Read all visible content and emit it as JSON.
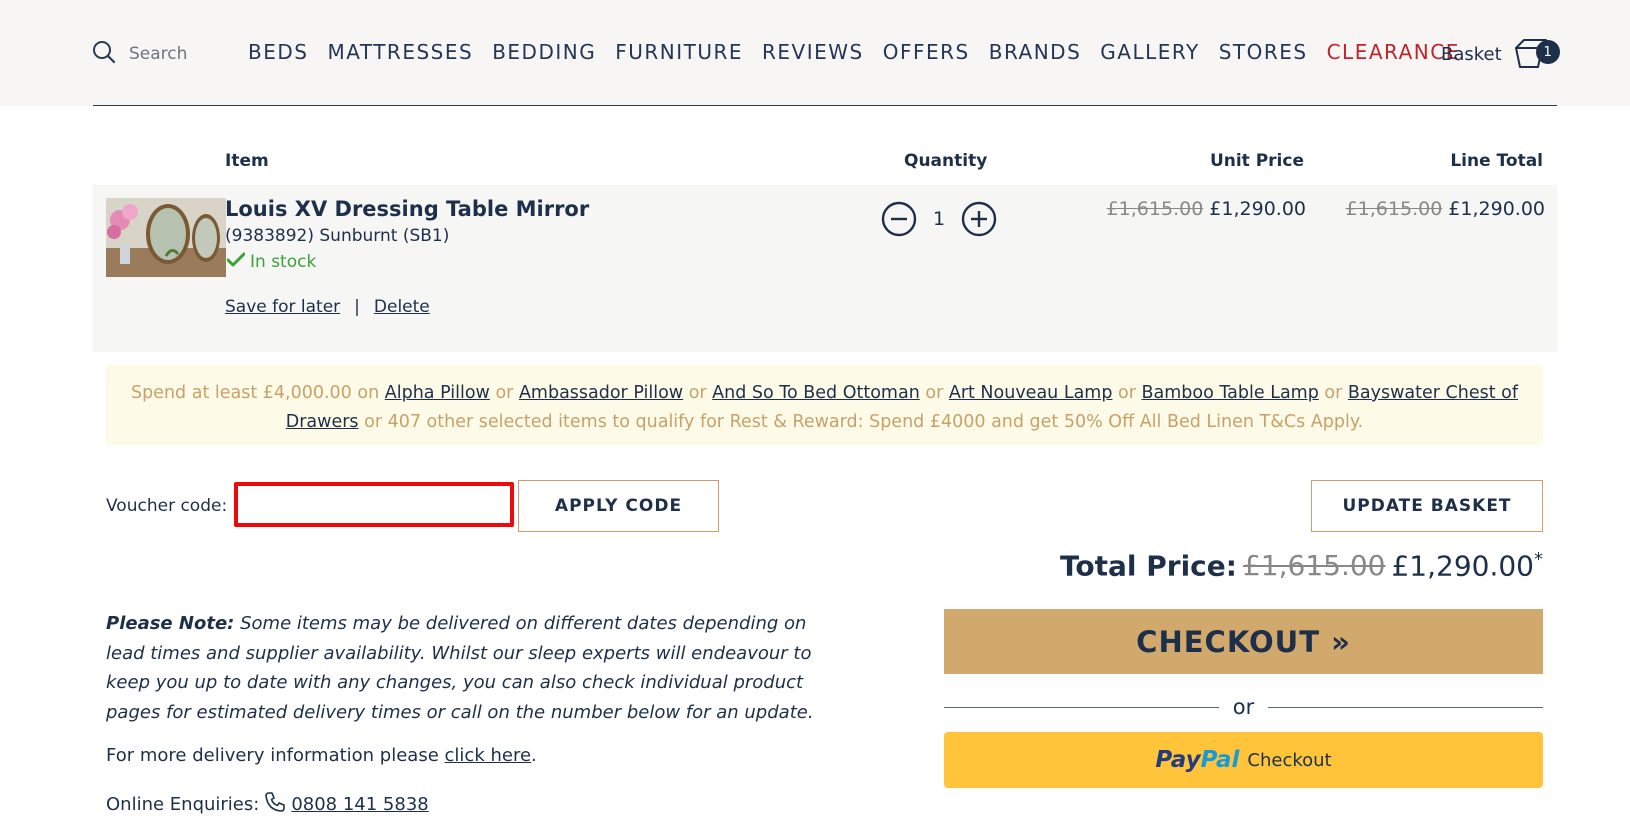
{
  "header": {
    "search_label": "Search",
    "nav": [
      "BEDS",
      "MATTRESSES",
      "BEDDING",
      "FURNITURE",
      "REVIEWS",
      "OFFERS",
      "BRANDS",
      "GALLERY",
      "STORES",
      "CLEARANCE"
    ],
    "basket_label": "Basket",
    "basket_count": "1"
  },
  "table": {
    "col_item": "Item",
    "col_quantity": "Quantity",
    "col_unit_price": "Unit Price",
    "col_line_total": "Line Total"
  },
  "item": {
    "name": "Louis XV Dressing Table Mirror",
    "sku": "(9383892) Sunburnt (SB1)",
    "stock": "In stock",
    "save_for_later": "Save for later",
    "separator": "|",
    "delete": "Delete",
    "quantity": "1",
    "unit_price_old": "£1,615.00",
    "unit_price": "£1,290.00",
    "line_total_old": "£1,615.00",
    "line_total": "£1,290.00"
  },
  "promo": {
    "intro": "Spend at least £4,000.00 on",
    "or": "or",
    "links": [
      "Alpha Pillow",
      "Ambassador Pillow",
      "And So To Bed Ottoman",
      "Art Nouveau Lamp",
      "Bamboo Table Lamp",
      "Bayswater Chest of Drawers"
    ],
    "outro": "or 407 other selected items to qualify for Rest & Reward: Spend £4000 and get 50% Off All Bed Linen T&Cs Apply."
  },
  "voucher": {
    "label": "Voucher code:",
    "value": "",
    "apply_label": "APPLY CODE",
    "update_label": "UPDATE BASKET"
  },
  "totals": {
    "label": "Total Price:",
    "old": "£1,615.00",
    "current": "£1,290.00",
    "asterisk": "*"
  },
  "checkout": {
    "label": "CHECKOUT »",
    "or": "or",
    "paypal_pay": "Pay",
    "paypal_pal": "Pal",
    "paypal_label": "Checkout"
  },
  "notes": {
    "please_note": "Please Note:",
    "note_text": "Some items may be delivered on different dates depending on lead times and supplier availability. Whilst our sleep experts will endeavour to keep you up to date with any changes, you can also check individual product pages for estimated delivery times or call on the number below for an update.",
    "delivery_text": "For more delivery information please",
    "click_here": "click here",
    "period": ".",
    "enquiries_label": "Online Enquiries:",
    "phone": "0808 141 5838"
  },
  "colors": {
    "navy": "#1e2f4a",
    "clearance_red": "#c4222a",
    "gold": "#d2a96d",
    "paypal_yellow": "#ffc43a",
    "stock_green": "#3aa23a",
    "highlight_red": "#ee0a0a"
  }
}
